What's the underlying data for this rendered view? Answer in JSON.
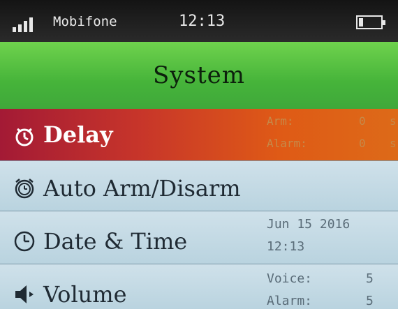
{
  "status_bar": {
    "carrier": "Mobifone",
    "time": "12:13",
    "signal_bars": 4,
    "battery_level": 0.2
  },
  "title": "System",
  "menu": {
    "delay": {
      "label": "Delay",
      "icon": "stopwatch-icon",
      "arm_label": "Arm:",
      "arm_value": "0",
      "arm_unit": "s",
      "alarm_label": "Alarm:",
      "alarm_value": "0",
      "alarm_unit": "s",
      "selected": true
    },
    "auto_arm": {
      "label": "Auto Arm/Disarm",
      "icon": "alarm-clock-icon"
    },
    "date_time": {
      "label": "Date & Time",
      "icon": "clock-icon",
      "date": "Jun 15 2016",
      "time": "12:13"
    },
    "volume": {
      "label": "Volume",
      "icon": "speaker-icon",
      "voice_label": "Voice:",
      "voice_value": "5",
      "alarm_label": "Alarm:",
      "alarm_value": "5"
    }
  },
  "colors": {
    "title_bar": "#4fbe3e",
    "selected_row_start": "#a31a35",
    "selected_row_end": "#dd6a18",
    "row_background": "#c6dbe5"
  }
}
